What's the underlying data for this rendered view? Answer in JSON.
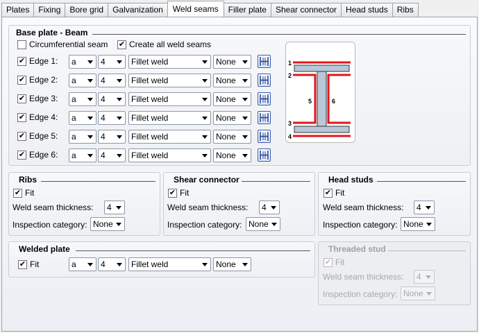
{
  "tabs": [
    "Plates",
    "Fixing",
    "Bore grid",
    "Galvanization",
    "Weld seams",
    "Filler plate",
    "Shear connector",
    "Head studs",
    "Ribs"
  ],
  "active_tab": "Weld seams",
  "base_plate": {
    "title": "Base plate - Beam",
    "circumferential_label": "Circumferential seam",
    "circumferential_checked": false,
    "create_all_label": "Create all weld seams",
    "create_all_checked": true,
    "edges": [
      {
        "label": "Edge 1:",
        "checked": true,
        "type": "a",
        "thickness": "4",
        "weld": "Fillet weld",
        "inspection": "None"
      },
      {
        "label": "Edge 2:",
        "checked": true,
        "type": "a",
        "thickness": "4",
        "weld": "Fillet weld",
        "inspection": "None"
      },
      {
        "label": "Edge 3:",
        "checked": true,
        "type": "a",
        "thickness": "4",
        "weld": "Fillet weld",
        "inspection": "None"
      },
      {
        "label": "Edge 4:",
        "checked": true,
        "type": "a",
        "thickness": "4",
        "weld": "Fillet weld",
        "inspection": "None"
      },
      {
        "label": "Edge 5:",
        "checked": true,
        "type": "a",
        "thickness": "4",
        "weld": "Fillet weld",
        "inspection": "None"
      },
      {
        "label": "Edge 6:",
        "checked": true,
        "type": "a",
        "thickness": "4",
        "weld": "Fillet weld",
        "inspection": "None"
      }
    ],
    "diagram_labels": [
      "1",
      "2",
      "3",
      "4",
      "5",
      "6"
    ]
  },
  "ribs": {
    "title": "Ribs",
    "fit_label": "Fit",
    "fit_checked": true,
    "thickness_label": "Weld seam thickness:",
    "thickness": "4",
    "inspection_label": "Inspection category:",
    "inspection": "None"
  },
  "shear_connector": {
    "title": "Shear connector",
    "fit_label": "Fit",
    "fit_checked": true,
    "thickness_label": "Weld seam thickness:",
    "thickness": "4",
    "inspection_label": "Inspection category:",
    "inspection": "None"
  },
  "head_studs": {
    "title": "Head studs",
    "fit_label": "Fit",
    "fit_checked": true,
    "thickness_label": "Weld seam thickness:",
    "thickness": "4",
    "inspection_label": "Inspection category:",
    "inspection": "None"
  },
  "welded_plate": {
    "title": "Welded plate",
    "fit_label": "Fit",
    "fit_checked": true,
    "type": "a",
    "thickness": "4",
    "weld": "Fillet weld",
    "inspection": "None"
  },
  "threaded_stud": {
    "title": "Threaded stud",
    "fit_label": "Fit",
    "fit_checked": true,
    "enabled": false,
    "thickness_label": "Weld seam thickness:",
    "thickness": "4",
    "inspection_label": "Inspection category:",
    "inspection": "None"
  },
  "colors": {
    "weld_red": "#e4141c",
    "plate_fill": "#b8c8d8",
    "tab_border": "#9aa3ad"
  }
}
